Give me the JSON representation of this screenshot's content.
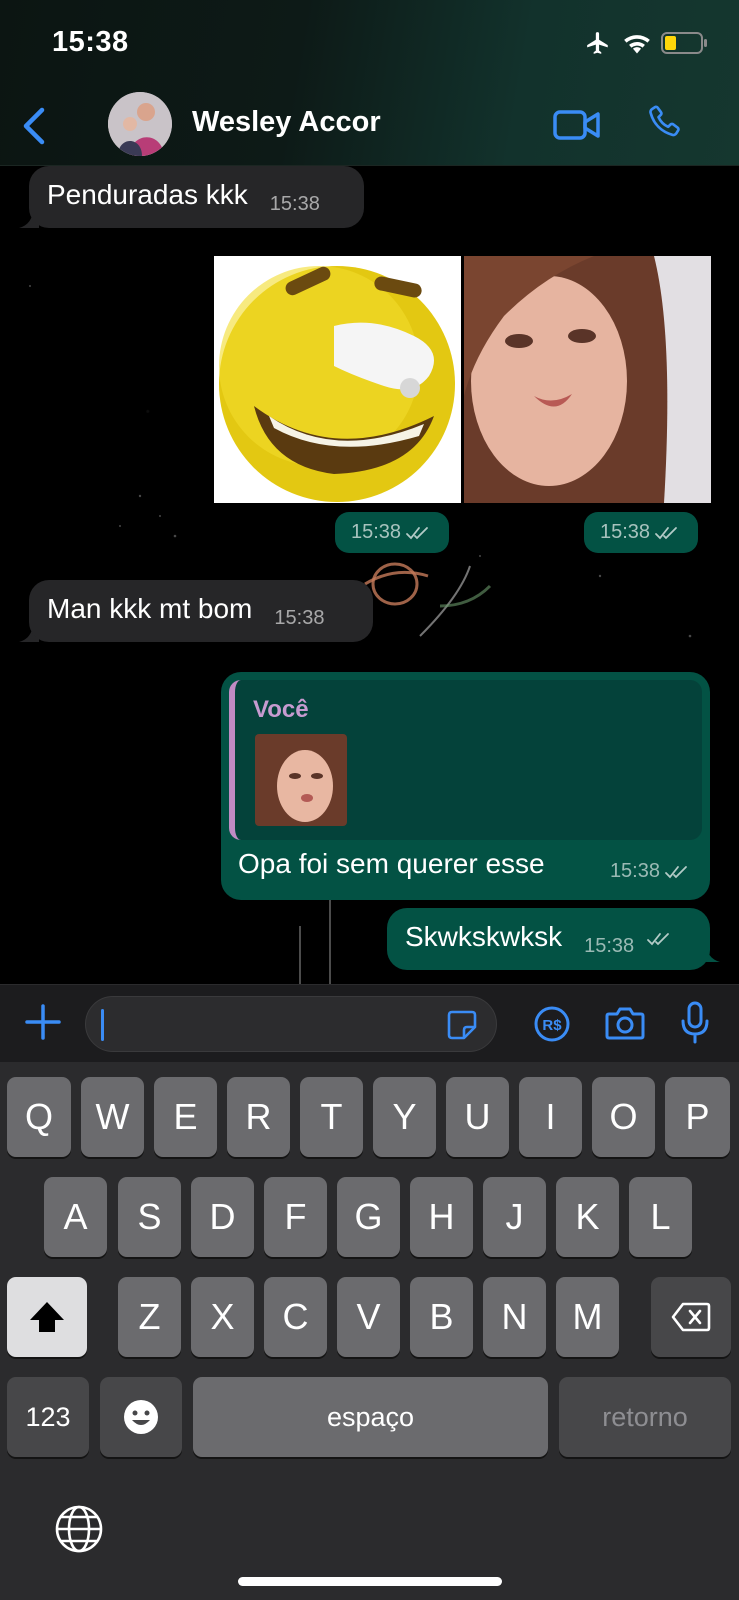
{
  "status_bar": {
    "time": "15:38",
    "icons": [
      "airplane-icon",
      "wifi-icon",
      "battery-low-icon"
    ]
  },
  "header": {
    "contact_name": "Wesley Accor",
    "icons": [
      "chevron-left-icon",
      "video-icon",
      "phone-icon"
    ]
  },
  "messages": [
    {
      "direction": "in",
      "text": "Penduradas kkk",
      "time": "15:38"
    },
    {
      "direction": "out",
      "type": "image",
      "description": "yellow emoji laughing",
      "time": "15:38",
      "status": "read"
    },
    {
      "direction": "out",
      "type": "image",
      "description": "woman selfie",
      "time": "15:38",
      "status": "read"
    },
    {
      "direction": "in",
      "text": "Man kkk mt bom",
      "time": "15:38"
    },
    {
      "direction": "out",
      "reply_to": {
        "author": "Você"
      },
      "text": "Opa foi sem querer esse",
      "time": "15:38",
      "status": "read"
    },
    {
      "direction": "out",
      "text": "Skwkskwksk",
      "time": "15:38",
      "status": "read"
    }
  ],
  "composer": {
    "value": "",
    "icons": [
      "plus-icon",
      "sticker-icon",
      "pix-icon",
      "camera-icon",
      "microphone-icon"
    ]
  },
  "keyboard": {
    "row1": [
      "Q",
      "W",
      "E",
      "R",
      "T",
      "Y",
      "U",
      "I",
      "O",
      "P"
    ],
    "row2": [
      "A",
      "S",
      "D",
      "F",
      "G",
      "H",
      "J",
      "K",
      "L"
    ],
    "row3": [
      "Z",
      "X",
      "C",
      "V",
      "B",
      "N",
      "M"
    ],
    "numbers_key": "123",
    "space_key": "espaço",
    "return_key": "retorno",
    "icons": [
      "shift-icon",
      "backspace-icon",
      "emoji-icon",
      "globe-icon"
    ]
  },
  "colors": {
    "accent": "#3a8cf5",
    "outgoing_bubble": "#035244",
    "incoming_bubble": "#262628",
    "reply_author": "#c79bd0"
  }
}
